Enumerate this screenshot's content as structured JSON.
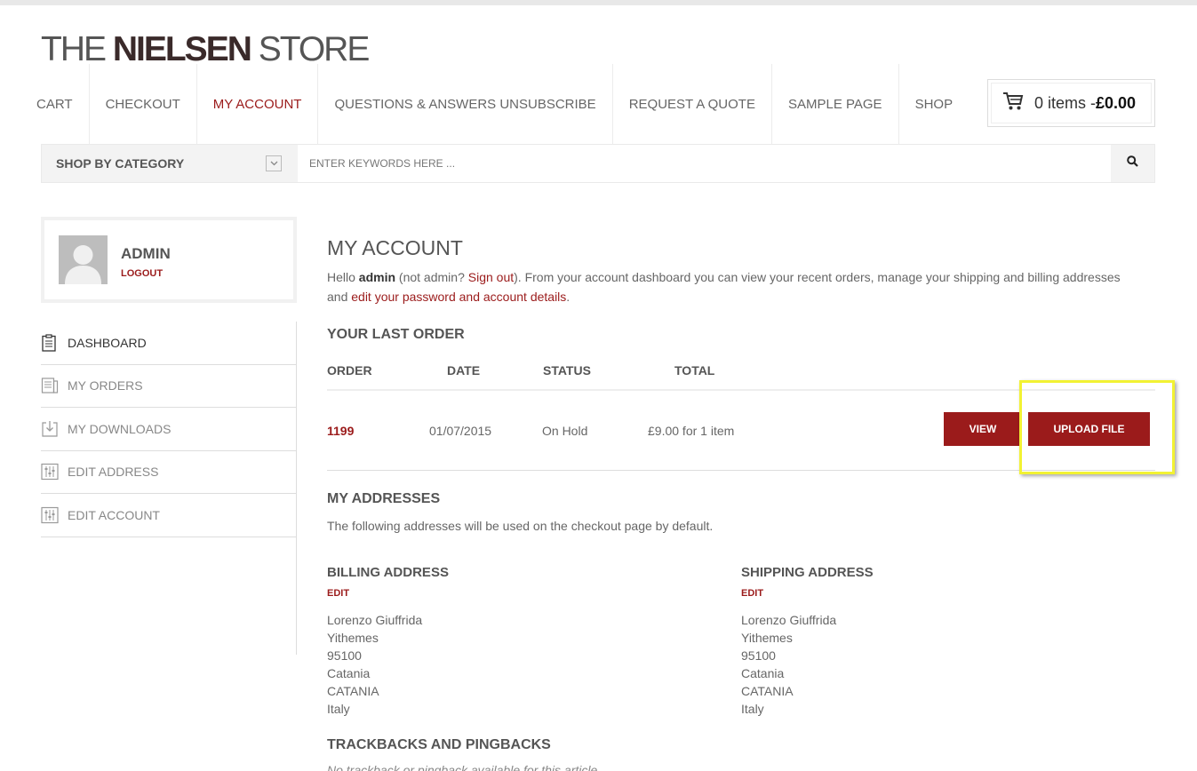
{
  "header": {
    "logo_part1": "THE ",
    "logo_part2": "NIELSEN",
    "logo_part3": " STORE",
    "nav": [
      {
        "label": "CART",
        "active": false
      },
      {
        "label": "CHECKOUT",
        "active": false
      },
      {
        "label": "MY ACCOUNT",
        "active": true
      },
      {
        "label": "QUESTIONS & ANSWERS UNSUBSCRIBE",
        "active": false
      },
      {
        "label": "REQUEST A QUOTE",
        "active": false
      },
      {
        "label": "SAMPLE PAGE",
        "active": false
      },
      {
        "label": "SHOP",
        "active": false
      }
    ],
    "cart": {
      "items_text": "0 items - ",
      "total": "£0.00"
    }
  },
  "search": {
    "category_label": "SHOP BY CATEGORY",
    "placeholder": "ENTER KEYWORDS HERE ..."
  },
  "user": {
    "name": "ADMIN",
    "logout_label": "LOGOUT"
  },
  "sidebar": {
    "items": [
      {
        "label": "DASHBOARD",
        "icon": "clipboard-icon"
      },
      {
        "label": "MY ORDERS",
        "icon": "orders-icon"
      },
      {
        "label": "MY DOWNLOADS",
        "icon": "download-icon"
      },
      {
        "label": "EDIT ADDRESS",
        "icon": "sliders-icon"
      },
      {
        "label": "EDIT ACCOUNT",
        "icon": "sliders-icon"
      }
    ]
  },
  "main": {
    "title": "MY ACCOUNT",
    "intro": {
      "hello": "Hello ",
      "user": "admin",
      "not_user": " (not admin? ",
      "sign_out": "Sign out",
      "middle": "). From your account dashboard you can view your recent orders, manage your shipping and billing addresses and ",
      "edit_link": "edit your password and account details",
      "end": "."
    },
    "last_order": {
      "heading": "YOUR LAST ORDER",
      "columns": [
        "ORDER",
        "DATE",
        "STATUS",
        "TOTAL"
      ],
      "order": "1199",
      "date": "01/07/2015",
      "status": "On Hold",
      "total": "£9.00 for 1 item",
      "view_label": "VIEW",
      "upload_label": "UPLOAD FILE"
    },
    "addresses": {
      "heading": "MY ADDRESSES",
      "description": "The following addresses will be used on the checkout page by default.",
      "billing": {
        "heading": "BILLING ADDRESS",
        "edit_label": "EDIT",
        "lines": [
          "Lorenzo Giuffrida",
          "Yithemes",
          "95100",
          "Catania",
          "CATANIA",
          "Italy"
        ]
      },
      "shipping": {
        "heading": "SHIPPING ADDRESS",
        "edit_label": "EDIT",
        "lines": [
          "Lorenzo Giuffrida",
          "Yithemes",
          "95100",
          "Catania",
          "CATANIA",
          "Italy"
        ]
      }
    },
    "trackbacks": {
      "heading": "TRACKBACKS AND PINGBACKS",
      "text": "No trackback or pingback available for this article"
    }
  },
  "colors": {
    "accent": "#9b1b1b",
    "highlight": "#f2f233"
  }
}
